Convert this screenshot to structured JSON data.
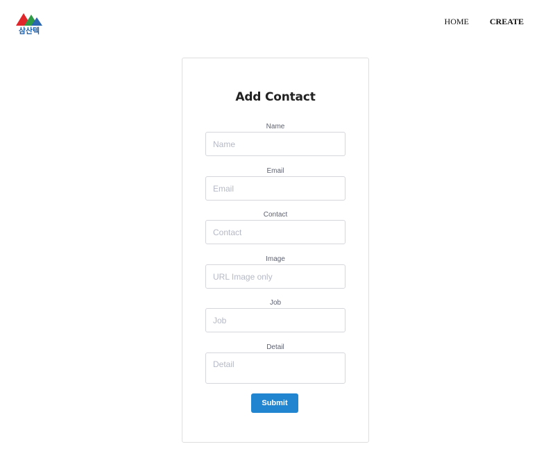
{
  "header": {
    "logo_text": "삼산텍",
    "nav": [
      {
        "label": "HOME",
        "active": false
      },
      {
        "label": "CREATE",
        "active": true
      }
    ]
  },
  "form": {
    "title": "Add Contact",
    "fields": [
      {
        "label": "Name",
        "placeholder": "Name",
        "value": ""
      },
      {
        "label": "Email",
        "placeholder": "Email",
        "value": ""
      },
      {
        "label": "Contact",
        "placeholder": "Contact",
        "value": ""
      },
      {
        "label": "Image",
        "placeholder": "URL Image only",
        "value": ""
      },
      {
        "label": "Job",
        "placeholder": "Job",
        "value": ""
      },
      {
        "label": "Detail",
        "placeholder": "Detail",
        "value": ""
      }
    ],
    "submit_label": "Submit"
  },
  "colors": {
    "accent": "#2185d0",
    "logo_red": "#e0262b",
    "logo_green": "#2f9a46",
    "logo_blue": "#2b66b1",
    "border": "#dedede"
  }
}
